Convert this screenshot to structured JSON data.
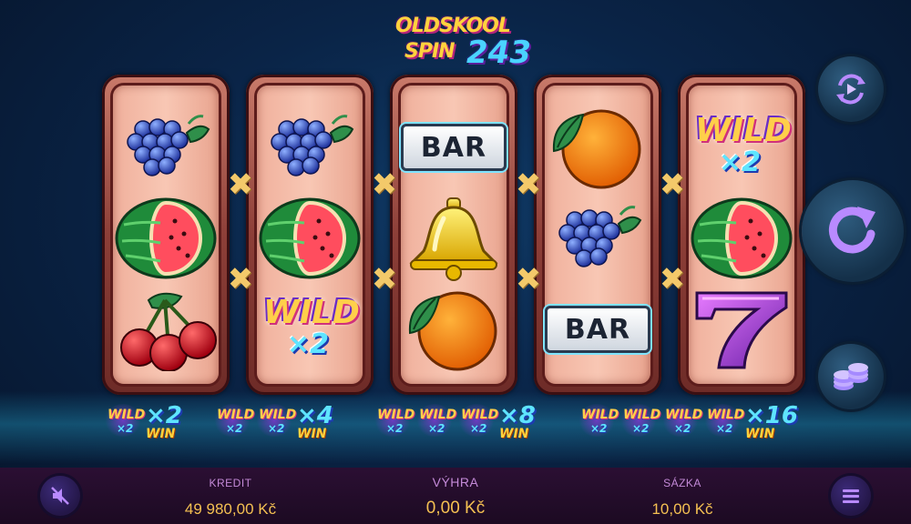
{
  "game": {
    "logo_line1": "OLDSKOOL",
    "logo_line2": "SPIN",
    "logo_number": "243"
  },
  "reels": [
    {
      "symbols": [
        "grapes",
        "watermelon",
        "cherries"
      ]
    },
    {
      "symbols": [
        "grapes",
        "watermelon",
        "wild-x2"
      ]
    },
    {
      "symbols": [
        "bar",
        "bell",
        "orange"
      ]
    },
    {
      "symbols": [
        "orange",
        "grapes",
        "bar"
      ]
    },
    {
      "symbols": [
        "wild-x2",
        "watermelon",
        "seven"
      ]
    }
  ],
  "symbol_text": {
    "bar": "BAR",
    "wild": "WILD",
    "wild_mult": "×2"
  },
  "multiplier_sign": "✖",
  "wild_bonus": [
    {
      "wild_count": 1,
      "multiplier": "×2",
      "label": "WIN"
    },
    {
      "wild_count": 2,
      "multiplier": "×4",
      "label": "WIN"
    },
    {
      "wild_count": 3,
      "multiplier": "×8",
      "label": "WIN"
    },
    {
      "wild_count": 4,
      "multiplier": "×16",
      "label": "WIN"
    }
  ],
  "controls": {
    "autoplay_icon": "autoplay-icon",
    "spin_icon": "spin-icon",
    "bet_icon": "coins-icon",
    "sound_icon": "sound-muted-icon",
    "menu_icon": "menu-icon"
  },
  "footer": {
    "credit_label": "KREDIT",
    "credit_value": "49 980,00 Kč",
    "win_label": "VÝHRA",
    "win_value": "0,00 Kč",
    "bet_label": "SÁZKA",
    "bet_value": "10,00 Kč"
  },
  "colors": {
    "accent_gold": "#f4c052",
    "label_purple": "#c48ad8",
    "reel_frame": "#8d3f38",
    "background": "#0a2447"
  }
}
